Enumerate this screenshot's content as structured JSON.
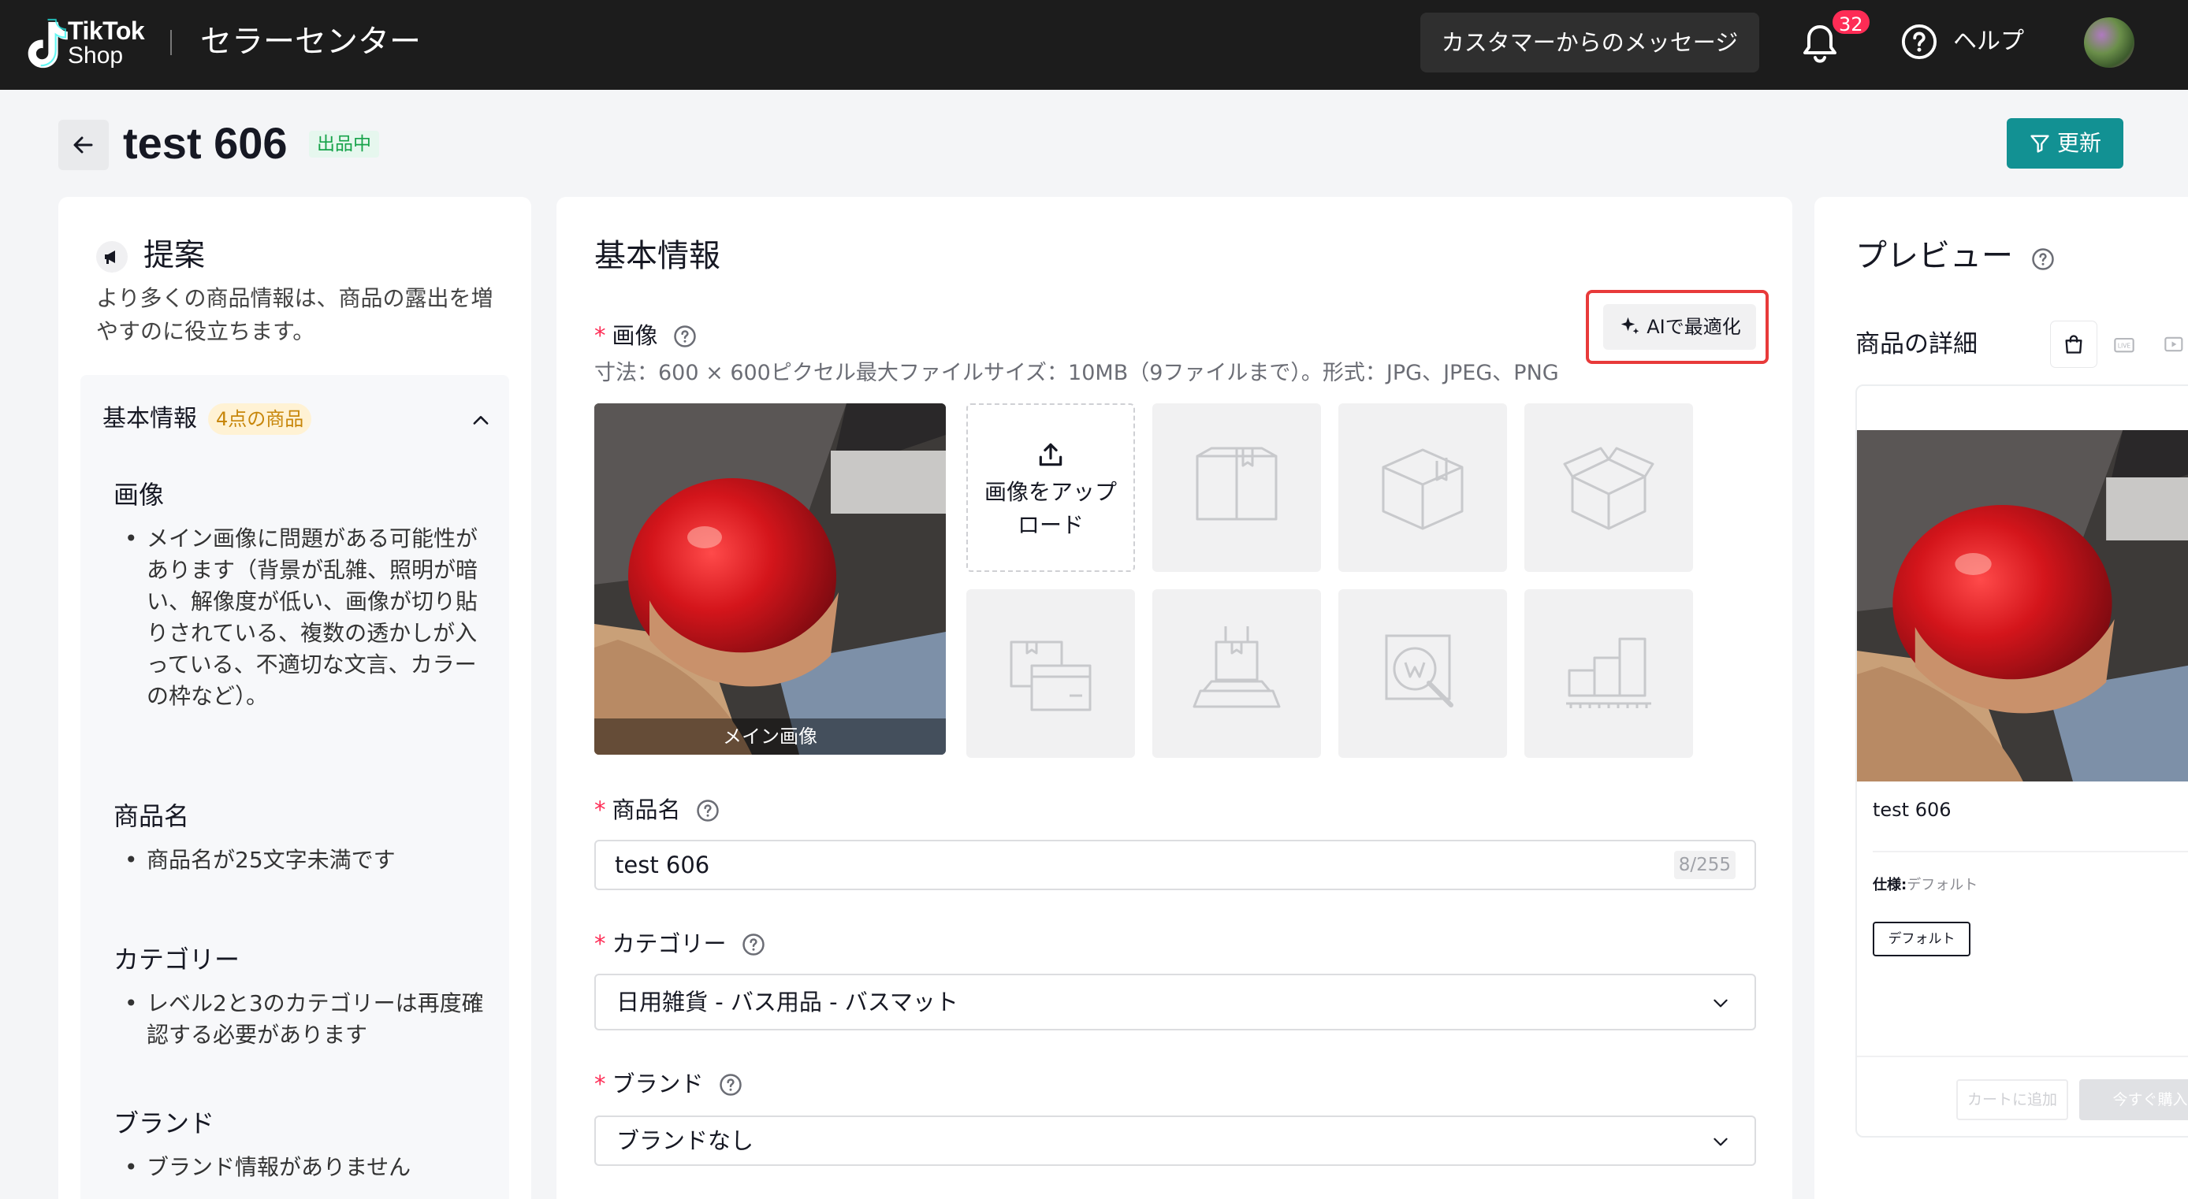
{
  "topbar": {
    "logo_line1": "TikTok",
    "logo_line2": "Shop",
    "app_title": "セラーセンター",
    "messages_button": "カスタマーからのメッセージ",
    "notification_count": "32",
    "help_label": "ヘルプ"
  },
  "header": {
    "title": "test 606",
    "status": "出品中",
    "update_button": "更新"
  },
  "suggestions": {
    "title": "提案",
    "description": "より多くの商品情報は、商品の露出を増やすのに役立ちます。",
    "group_title": "基本情報",
    "group_badge": "4点の商品",
    "sections": [
      {
        "title": "画像",
        "item": "メイン画像に問題がある可能性があります（背景が乱雑、照明が暗い、解像度が低い、画像が切り貼りされている、複数の透かしが入っている、不適切な文言、カラーの枠など）。"
      },
      {
        "title": "商品名",
        "item": "商品名が25文字未満です"
      },
      {
        "title": "カテゴリー",
        "item": "レベル2と3のカテゴリーは再度確認する必要があります"
      },
      {
        "title": "ブランド",
        "item": "ブランド情報がありません"
      }
    ]
  },
  "basic_info": {
    "title": "基本情報",
    "ai_button": "AIで最適化",
    "image_label": "画像",
    "image_specs": "寸法：600 × 600ピクセル最大ファイルサイズ：10MB（9ファイルまで）。形式：JPG、JPEG、PNG",
    "main_image_caption": "メイン画像",
    "upload_label": "画像をアップロード",
    "product_name_label": "商品名",
    "product_name_value": "test 606",
    "product_name_count": "8/255",
    "category_label": "カテゴリー",
    "category_value": "日用雑貨 - バス用品 - バスマット",
    "brand_label": "ブランド",
    "brand_value": "ブランドなし"
  },
  "preview": {
    "title": "プレビュー",
    "subtitle": "商品の詳細",
    "tabs": [
      "bag-icon",
      "live-icon",
      "video-icon"
    ],
    "product_name": "test 606",
    "spec_label": "仕様:",
    "spec_value": "デフォルト",
    "spec_chip": "デフォルト",
    "add_to_cart": "カートに追加",
    "buy_now": "今すぐ購入"
  },
  "colors": {
    "topbar": "#1c1c1c",
    "accent": "#129193",
    "required": "#fe2c55",
    "highlight_frame": "#e83a3a",
    "status_green": "#17a34a"
  }
}
